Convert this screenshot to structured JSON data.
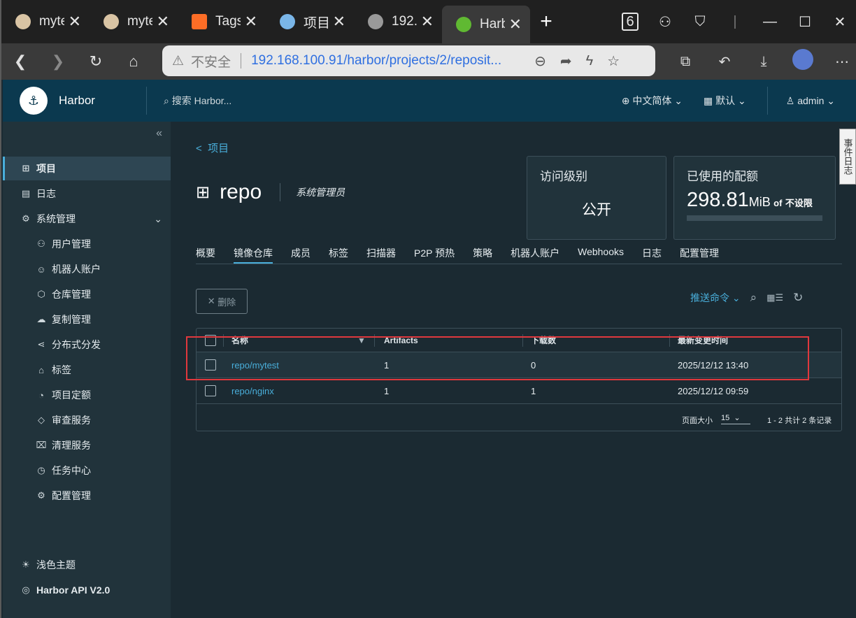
{
  "browser": {
    "tabs": [
      {
        "title": "myte",
        "icon": "jenkins-icon",
        "color": "#d9c4a4"
      },
      {
        "title": "myte",
        "icon": "jenkins-icon",
        "color": "#d9c4a4"
      },
      {
        "title": "Tags",
        "icon": "gitlab-icon",
        "color": "#fc6d26"
      },
      {
        "title": "项目",
        "icon": "project-icon",
        "color": "#7ab6e8"
      },
      {
        "title": "192.",
        "icon": "globe-icon",
        "color": "#9a9a9a"
      },
      {
        "title": "Harb",
        "icon": "harbor-icon",
        "color": "#60b932"
      }
    ],
    "new_tab": "+",
    "tab_count": "6",
    "address": {
      "warning": "不安全",
      "url": "192.168.100.91/harbor/projects/2/reposit..."
    }
  },
  "header": {
    "brand": "Harbor",
    "search_placeholder": "搜索 Harbor...",
    "language": "中文简体",
    "theme": "默认",
    "user": "admin"
  },
  "sidebar": {
    "items": [
      {
        "label": "项目",
        "active": true
      },
      {
        "label": "日志"
      },
      {
        "label": "系统管理"
      },
      {
        "label": "用户管理"
      },
      {
        "label": "机器人账户"
      },
      {
        "label": "仓库管理"
      },
      {
        "label": "复制管理"
      },
      {
        "label": "分布式分发"
      },
      {
        "label": "标签"
      },
      {
        "label": "项目定额"
      },
      {
        "label": "审查服务"
      },
      {
        "label": "清理服务"
      },
      {
        "label": "任务中心"
      },
      {
        "label": "配置管理"
      }
    ],
    "theme_toggle": "浅色主题",
    "api": "Harbor API V2.0"
  },
  "main": {
    "back": "项目",
    "project_name": "repo",
    "role": "系统管理员",
    "access_card": {
      "title": "访问级别",
      "value": "公开"
    },
    "quota_card": {
      "title": "已使用的配额",
      "value": "298.81",
      "unit": "MiB",
      "of": "of",
      "limit": "不设限"
    },
    "tabs": [
      "概要",
      "镜像仓库",
      "成员",
      "标签",
      "扫描器",
      "P2P 预热",
      "策略",
      "机器人账户",
      "Webhooks",
      "日志",
      "配置管理"
    ],
    "active_tab": "镜像仓库",
    "delete": "删除",
    "push_command": "推送命令",
    "table": {
      "headers": [
        "名称",
        "Artifacts",
        "下载数",
        "最新变更时间"
      ],
      "rows": [
        {
          "name": "repo/mytest",
          "artifacts": "1",
          "downloads": "0",
          "time": "2025/12/12 13:40"
        },
        {
          "name": "repo/nginx",
          "artifacts": "1",
          "downloads": "1",
          "time": "2025/12/12 09:59"
        }
      ],
      "page_size_label": "页面大小",
      "page_size": "15",
      "summary": "1 - 2 共计 2 条记录"
    }
  },
  "feedback": "事件日志"
}
